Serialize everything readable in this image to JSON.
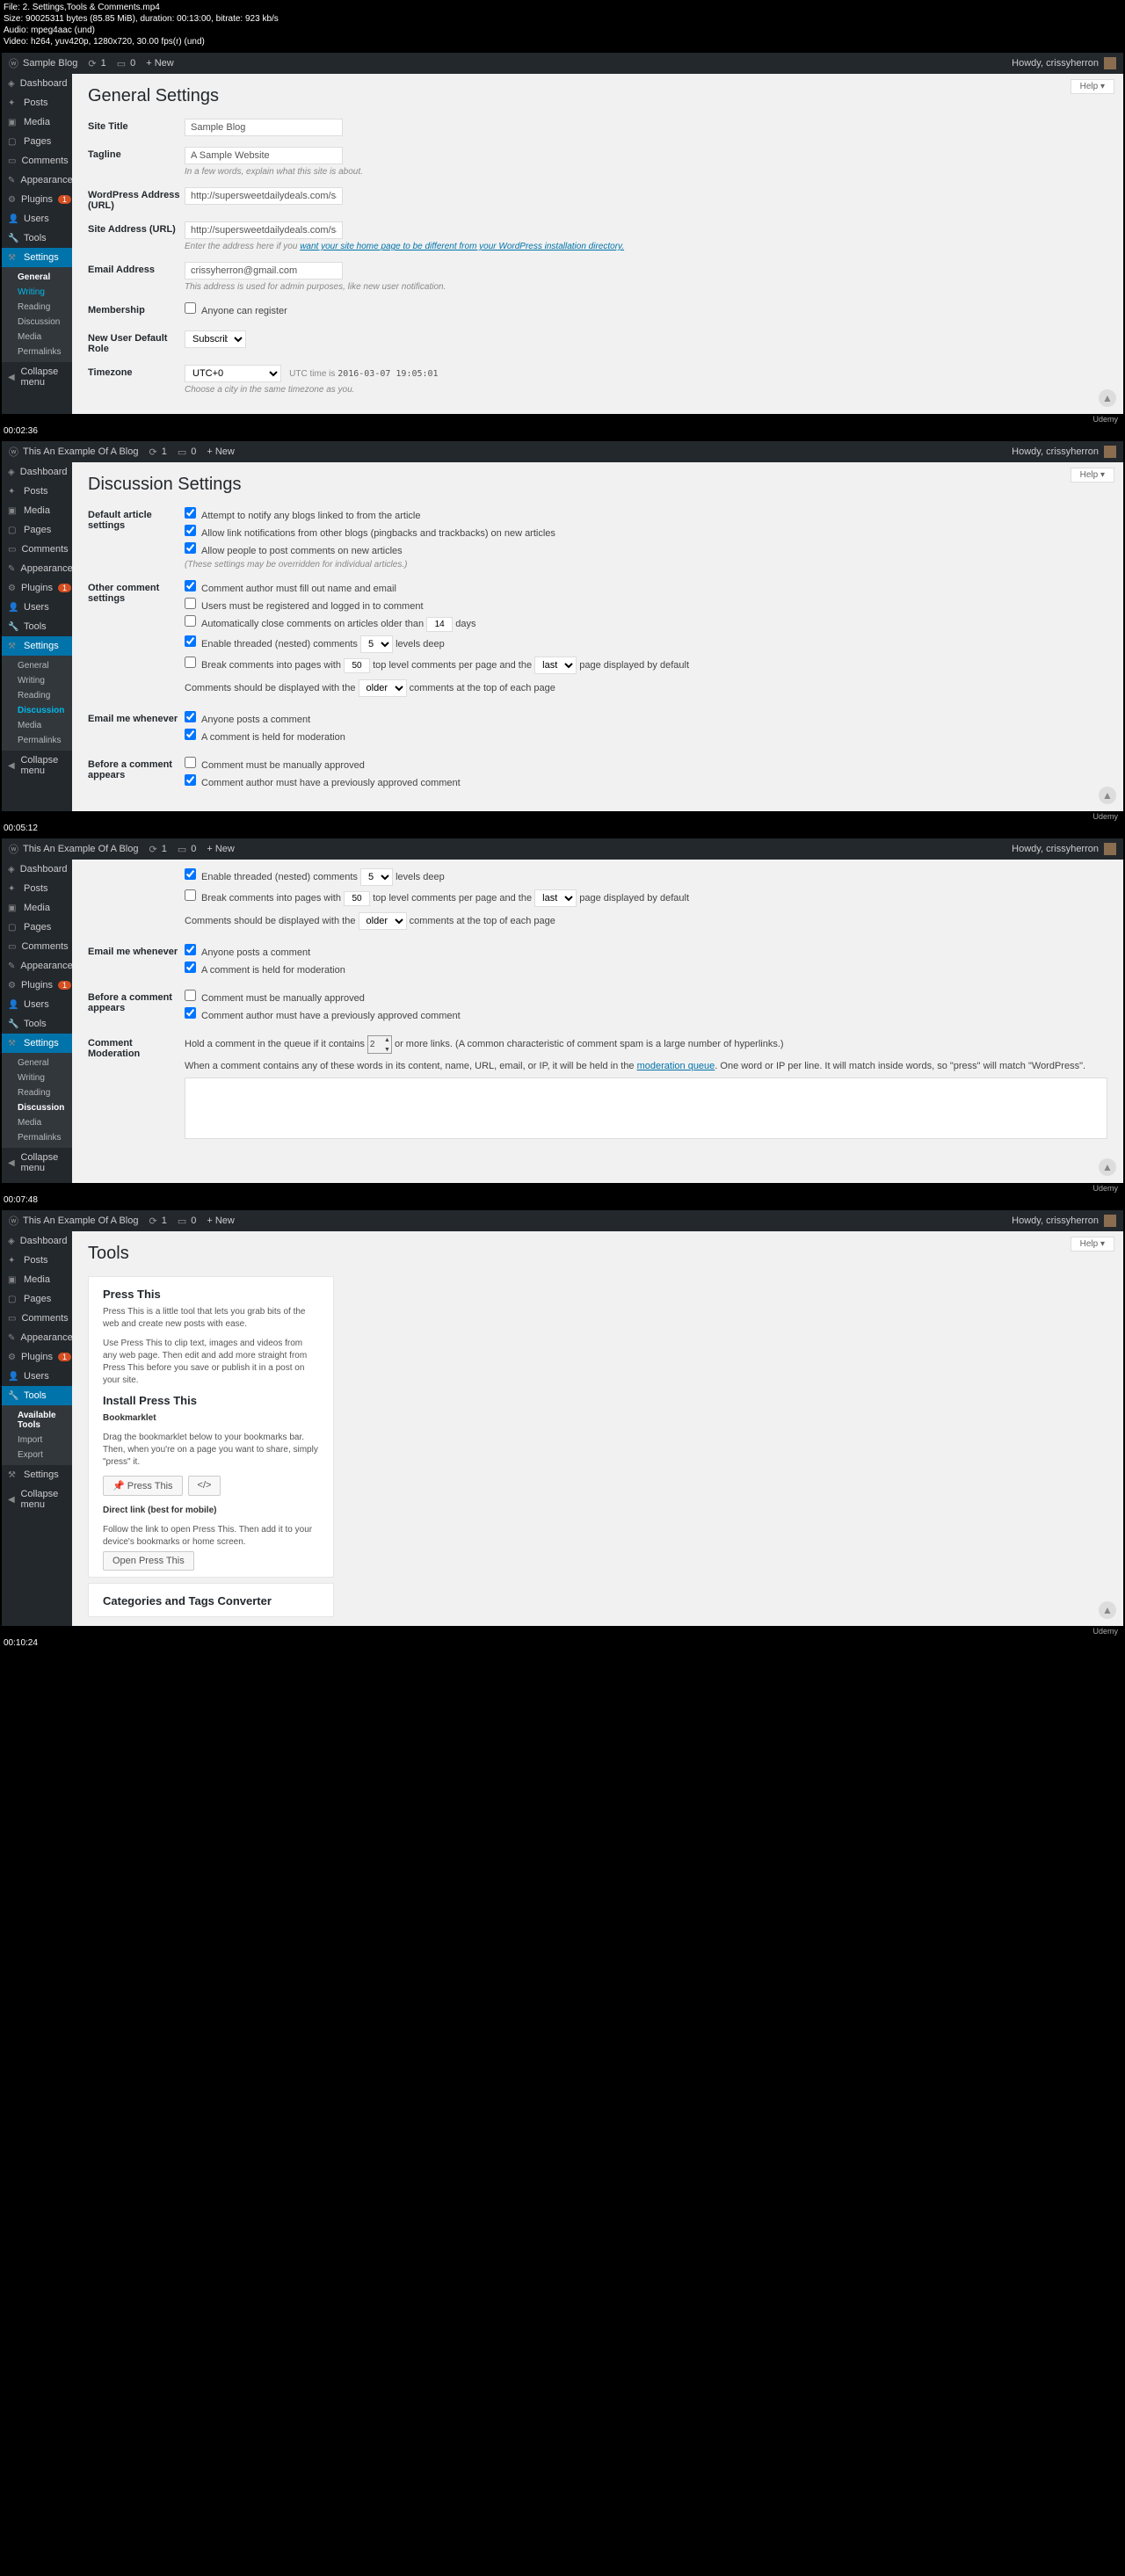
{
  "meta": {
    "file": "File: 2. Settings,Tools & Comments.mp4",
    "size": "Size: 90025311 bytes (85.85 MiB), duration: 00:13:00, bitrate: 923 kb/s",
    "audio": "Audio: mpeg4aac (und)",
    "video": "Video: h264, yuv420p, 1280x720, 30.00 fps(r) (und)"
  },
  "howdy": "Howdy, crissyherron",
  "help": "Help ▾",
  "topbar": {
    "site1": "Sample Blog",
    "site2": "This An Example Of A Blog",
    "updates": "1",
    "comments": "0",
    "new": "+ New"
  },
  "menu": {
    "dashboard": "Dashboard",
    "posts": "Posts",
    "media": "Media",
    "pages": "Pages",
    "comments": "Comments",
    "appearance": "Appearance",
    "plugins": "Plugins",
    "pluginsBadge": "1",
    "users": "Users",
    "tools": "Tools",
    "settings": "Settings",
    "collapse": "Collapse menu",
    "available": "Available Tools",
    "import": "Import",
    "export": "Export"
  },
  "subset": {
    "general": "General",
    "writing": "Writing",
    "reading": "Reading",
    "discussion": "Discussion",
    "media": "Media",
    "permalinks": "Permalinks"
  },
  "f1": {
    "title": "General Settings",
    "siteTitle": "Site Title",
    "siteTitleVal": "Sample Blog",
    "tagline": "Tagline",
    "taglineVal": "A Sample Website",
    "taglineHint": "In a few words, explain what this site is about.",
    "wpurl": "WordPress Address (URL)",
    "wpurlVal": "http://supersweetdailydeals.com/sample-blog",
    "surl": "Site Address (URL)",
    "surlVal": "http://supersweetdailydeals.com/sample-blog",
    "surlHint1": "Enter the address here if you ",
    "surlHint2": "want your site home page to be different from your WordPress installation directory.",
    "email": "Email Address",
    "emailVal": "crissyherron@gmail.com",
    "emailHint": "This address is used for admin purposes, like new user notification.",
    "membership": "Membership",
    "anyoneReg": "Anyone can register",
    "newrole": "New User Default Role",
    "newroleVal": "Subscriber",
    "timezone": "Timezone",
    "tzVal": "UTC+0",
    "tzUtc": "UTC time is",
    "tzTime": "2016-03-07 19:05:01",
    "tzHint": "Choose a city in the same timezone as you.",
    "tc": "00:02:36"
  },
  "f2": {
    "title": "Discussion Settings",
    "das": "Default article settings",
    "das1": "Attempt to notify any blogs linked to from the article",
    "das2": "Allow link notifications from other blogs (pingbacks and trackbacks) on new articles",
    "das3": "Allow people to post comments on new articles",
    "dasHint": "(These settings may be overridden for individual articles.)",
    "ocs": "Other comment settings",
    "ocs1": "Comment author must fill out name and email",
    "ocs2": "Users must be registered and logged in to comment",
    "ocs3a": "Automatically close comments on articles older than",
    "ocs3v": "14",
    "ocs3b": "days",
    "ocs4a": "Enable threaded (nested) comments",
    "ocs4v": "5",
    "ocs4b": "levels deep",
    "ocs5a": "Break comments into pages with",
    "ocs5v": "50",
    "ocs5b": "top level comments per page and the",
    "ocs5s": "last",
    "ocs5c": "page displayed by default",
    "ocs6a": "Comments should be displayed with the",
    "ocs6s": "older",
    "ocs6b": "comments at the top of each page",
    "emw": "Email me whenever",
    "emw1": "Anyone posts a comment",
    "emw2": "A comment is held for moderation",
    "bca": "Before a comment appears",
    "bca1": "Comment must be manually approved",
    "bca2": "Comment author must have a previously approved comment",
    "tc": "00:05:12"
  },
  "f3": {
    "cmod": "Comment Moderation",
    "cmod1a": "Hold a comment in the queue if it contains",
    "cmod1v": "2",
    "cmod1b": "or more links. (A common characteristic of comment spam is a large number of hyperlinks.)",
    "cmod2a": "When a comment contains any of these words in its content, name, URL, email, or IP, it will be held in the ",
    "cmod2link": "moderation queue",
    "cmod2b": ". One word or IP per line. It will match inside words, so \"press\" will match \"WordPress\".",
    "tc": "00:07:48"
  },
  "f4": {
    "title": "Tools",
    "pt": "Press This",
    "pt1": "Press This is a little tool that lets you grab bits of the web and create new posts with ease.",
    "pt2": "Use Press This to clip text, images and videos from any web page. Then edit and add more straight from Press This before you save or publish it in a post on your site.",
    "ipt": "Install Press This",
    "bm": "Bookmarklet",
    "bm1": "Drag the bookmarklet below to your bookmarks bar. Then, when you're on a page you want to share, simply \"press\" it.",
    "ptbtn": "Press This",
    "dl": "Direct link (best for mobile)",
    "dl1": "Follow the link to open Press This. Then add it to your device's bookmarks or home screen.",
    "dlbtn": "Open Press This",
    "cat": "Categories and Tags Converter",
    "tc": "00:10:24"
  },
  "wm": "Udemy"
}
